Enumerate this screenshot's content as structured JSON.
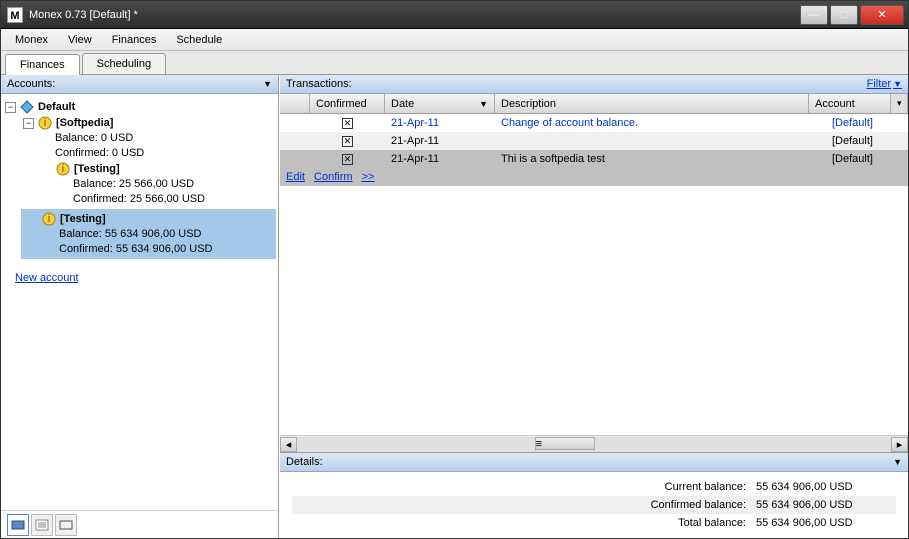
{
  "window": {
    "title": "Monex 0.73 [Default] *"
  },
  "menu": {
    "items": [
      "Monex",
      "View",
      "Finances",
      "Schedule"
    ]
  },
  "tabs": {
    "items": [
      "Finances",
      "Scheduling"
    ],
    "active": 0
  },
  "sidebar": {
    "header": "Accounts:",
    "root": {
      "label": "Default",
      "children": [
        {
          "label": "[Softpedia]",
          "balance": "Balance:  0  USD",
          "confirmed": "Confirmed:  0  USD",
          "children": [
            {
              "label": "[Testing]",
              "balance": "Balance:  25 566,00  USD",
              "confirmed": "Confirmed:  25 566,00  USD"
            }
          ]
        },
        {
          "label": "[Testing]",
          "balance": "Balance:  55 634 906,00  USD",
          "confirmed": "Confirmed:  55 634 906,00  USD",
          "selected": true
        }
      ]
    },
    "new_account": "New account"
  },
  "transactions": {
    "header": "Transactions:",
    "filter_label": "Filter",
    "columns": {
      "confirmed": "Confirmed",
      "date": "Date",
      "description": "Description",
      "account": "Account"
    },
    "rows": [
      {
        "confirmed": true,
        "date": "21-Apr-11",
        "description": "Change of account balance.",
        "account": "[Default]",
        "highlight": "blue"
      },
      {
        "confirmed": true,
        "date": "21-Apr-11",
        "description": "",
        "account": "[Default]"
      },
      {
        "confirmed": true,
        "date": "21-Apr-11",
        "description": "Thi is a softpedia test",
        "account": "[Default]",
        "highlight": "gray"
      }
    ],
    "actions": {
      "edit": "Edit",
      "confirm": "Confirm",
      "more": ">>"
    }
  },
  "details": {
    "header": "Details:",
    "rows": [
      {
        "label": "Current balance:",
        "value": "55 634 906,00  USD"
      },
      {
        "label": "Confirmed balance:",
        "value": "55 634 906,00  USD",
        "alt": true
      },
      {
        "label": "Total balance:",
        "value": "55 634 906,00  USD"
      }
    ]
  }
}
